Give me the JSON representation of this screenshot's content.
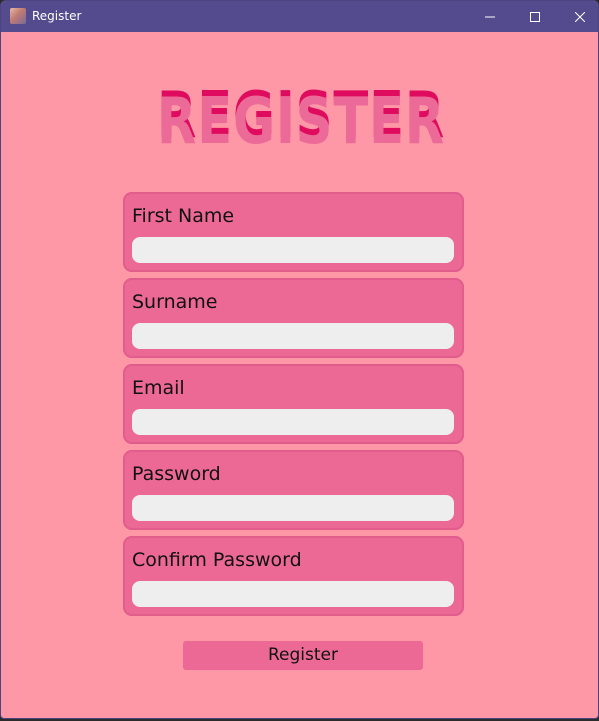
{
  "window": {
    "title": "Register",
    "controls": {
      "minimize": "minimize-icon",
      "maximize": "maximize-icon",
      "close": "close-icon"
    }
  },
  "form": {
    "heading": "REGISTER",
    "fields": [
      {
        "label": "First Name",
        "value": ""
      },
      {
        "label": "Surname",
        "value": ""
      },
      {
        "label": "Email",
        "value": ""
      },
      {
        "label": "Password",
        "value": ""
      },
      {
        "label": "Confirm Password",
        "value": ""
      }
    ],
    "submit_label": "Register"
  },
  "colors": {
    "background": "#ff98a6",
    "titlebar": "#544b8e",
    "field_box": "#ec6895",
    "input": "#eeeeee",
    "heading_fill": "#ec6a97",
    "heading_shadow": "#de0b5e"
  }
}
